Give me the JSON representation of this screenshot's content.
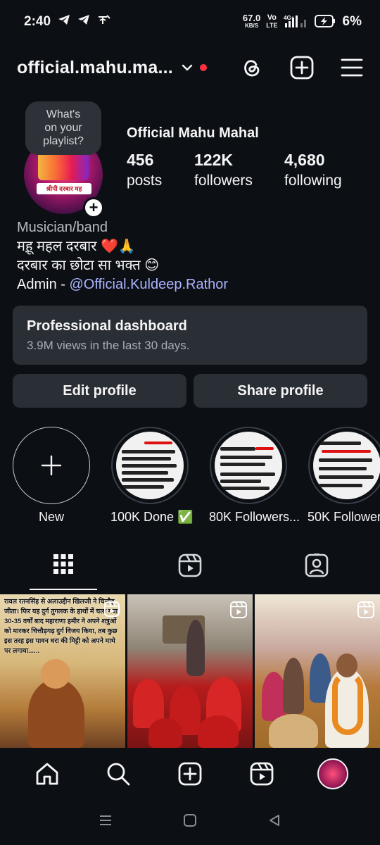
{
  "status_bar": {
    "time": "2:40",
    "net_speed_value": "67.0",
    "net_speed_unit": "KB/S",
    "carrier": "Vo",
    "carrier_sub": "LTE",
    "signal_label": "4G+",
    "battery": "6%"
  },
  "header": {
    "username": "official.mahu.ma..."
  },
  "profile": {
    "note_line1": "What's",
    "note_line2": "on your",
    "note_line3": "playlist?",
    "avatar_banner": "श्रीपी दरबार मह",
    "display_name": "Official Mahu Mahal",
    "stats": [
      {
        "value": "456",
        "label": "posts"
      },
      {
        "value": "122K",
        "label": "followers"
      },
      {
        "value": "4,680",
        "label": "following"
      }
    ]
  },
  "bio": {
    "category": "Musician/band",
    "line1": "मह़ू महल दरबार ❤️🙏",
    "line2": "दरबार का छोटा सा भक्त 😊",
    "admin_prefix": "Admin - ",
    "admin_mention": "@Official.Kuldeep.Rathor"
  },
  "dashboard": {
    "title": "Professional dashboard",
    "subtitle": "3.9M views in the last 30 days."
  },
  "actions": {
    "edit": "Edit profile",
    "share": "Share profile"
  },
  "highlights": [
    {
      "label": "New"
    },
    {
      "label": "100K Done ✅"
    },
    {
      "label": "80K Followers..."
    },
    {
      "label": "50K Followers"
    }
  ],
  "posts": {
    "post1_caption": "रावल रतनसिंह से अलाउद्दीन खिलजी ने चित्तौड़ जीता। फिर यह दुर्ग तुगलक के हाथों में चला गया। 30-35 वर्षों बाद महाराणा हमीर ने अपने शत्रुओं को मारकर चित्तौड़गढ़ दुर्ग विजय किया, तब कुछ इस तरह इस पावन धरा की मिट्टी को अपने माथे पर लगाया......"
  },
  "colors": {
    "background": "#0c0f14",
    "card": "#2a2e35",
    "mention": "#aab4ff",
    "live_dot": "#ff3040"
  }
}
